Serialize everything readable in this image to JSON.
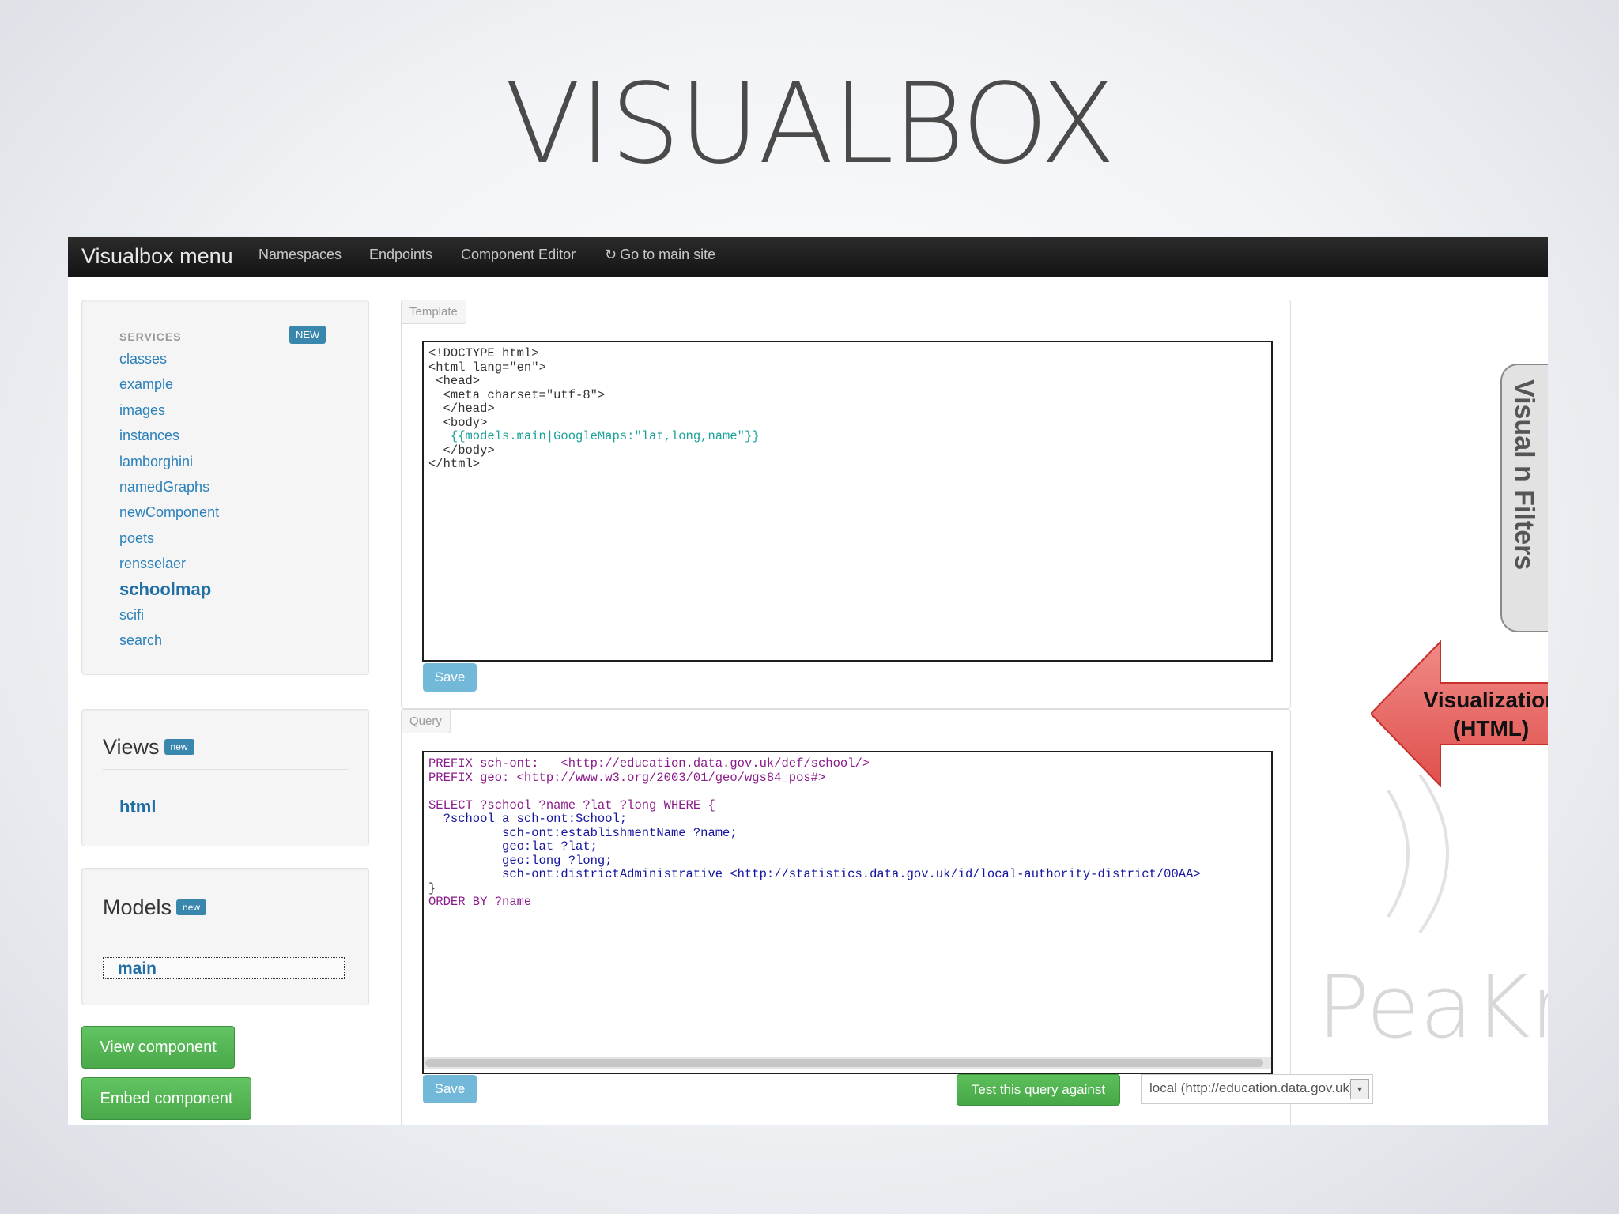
{
  "slide": {
    "title": "VISUALBOX"
  },
  "navbar": {
    "brand": "Visualbox menu",
    "items": [
      "Namespaces",
      "Endpoints",
      "Component Editor",
      "Go to main site"
    ],
    "main_site_icon": "refresh-icon"
  },
  "services": {
    "header": "SERVICES",
    "badge": "NEW",
    "items": [
      "classes",
      "example",
      "images",
      "instances",
      "lamborghini",
      "namedGraphs",
      "newComponent",
      "poets",
      "rensselaer",
      "schoolmap",
      "scifi",
      "search"
    ],
    "active": "schoolmap"
  },
  "views": {
    "title": "Views",
    "badge": "new",
    "items": [
      "html"
    ]
  },
  "models": {
    "title": "Models",
    "badge": "new",
    "selected": "main"
  },
  "buttons": {
    "view_component": "View component",
    "embed_component": "Embed component"
  },
  "template_pane": {
    "label": "Template",
    "lines": [
      "<!DOCTYPE html>",
      "<html lang=\"en\">",
      " <head>",
      "  <meta charset=\"utf-8\">",
      "  </head>",
      "  <body>",
      "   {{models.main|GoogleMaps:\"lat,long,name\"}}",
      "  </body>",
      "</html>"
    ],
    "save_label": "Save"
  },
  "query_pane": {
    "label": "Query",
    "lines": [
      "PREFIX sch-ont:   <http://education.data.gov.uk/def/school/>",
      "PREFIX geo: <http://www.w3.org/2003/01/geo/wgs84_pos#>",
      "",
      "SELECT ?school ?name ?lat ?long WHERE {",
      "  ?school a sch-ont:School;",
      "          sch-ont:establishmentName ?name;",
      "          geo:lat ?lat;",
      "          geo:long ?long;",
      "          sch-ont:districtAdministrative <http://statistics.data.gov.uk/id/local-authority-district/00AA>",
      "}",
      "ORDER BY ?name"
    ],
    "save_label": "Save",
    "test_label": "Test this query against",
    "endpoint_value": "local (http://education.data.gov.uk)"
  },
  "side_tab": {
    "label": "Visualization Filters",
    "visible_text": "Visual  n Filters"
  },
  "callout": {
    "line1": "Visualization",
    "line2": "(HTML)",
    "color": "#e8625f"
  },
  "watermark": {
    "text": "PeaKr"
  },
  "colors": {
    "navbar": "#1b1b1b",
    "link": "#2a80b9",
    "badge": "#3a87ad",
    "green": "#4aa94a",
    "save": "#72b8d8"
  }
}
